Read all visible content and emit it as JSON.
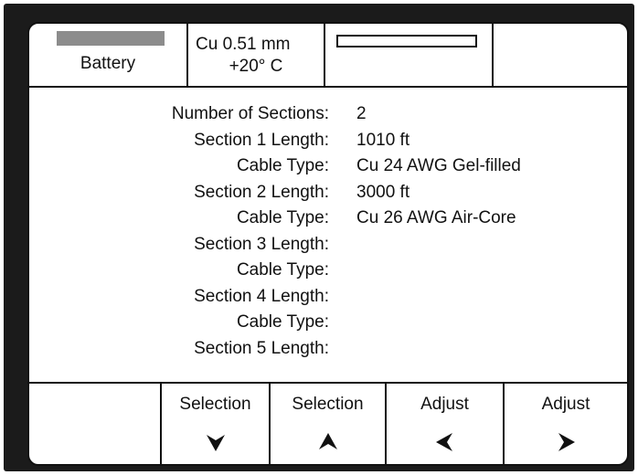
{
  "header": {
    "battery_label": "Battery",
    "battery_level": 1.0,
    "cable_line1": "Cu 0.51 mm",
    "cable_line2": "+20° C",
    "progress_level": 0.0,
    "empty_cell": ""
  },
  "parameters": [
    {
      "label": "Number of Sections:",
      "value": "2"
    },
    {
      "label": "Section 1 Length:",
      "value": "1010 ft"
    },
    {
      "label": "Cable Type:",
      "value": "Cu 24 AWG Gel-filled"
    },
    {
      "label": "Section 2 Length:",
      "value": "3000 ft"
    },
    {
      "label": "Cable Type:",
      "value": "Cu 26 AWG Air-Core"
    },
    {
      "label": "Section 3 Length:",
      "value": ""
    },
    {
      "label": "Cable Type:",
      "value": ""
    },
    {
      "label": "Section 4 Length:",
      "value": ""
    },
    {
      "label": "Cable Type:",
      "value": ""
    },
    {
      "label": "Section 5 Length:",
      "value": ""
    }
  ],
  "softkeys": [
    {
      "label": "",
      "icon": ""
    },
    {
      "label": "Selection",
      "icon": "arrow-down-icon"
    },
    {
      "label": "Selection",
      "icon": "arrow-up-icon"
    },
    {
      "label": "Adjust",
      "icon": "arrow-left-icon"
    },
    {
      "label": "Adjust",
      "icon": "arrow-right-icon"
    }
  ],
  "colors": {
    "bezel": "#1b1b1b",
    "screen": "#ffffff",
    "ink": "#111111",
    "battery_fill": "#8c8c8c"
  }
}
